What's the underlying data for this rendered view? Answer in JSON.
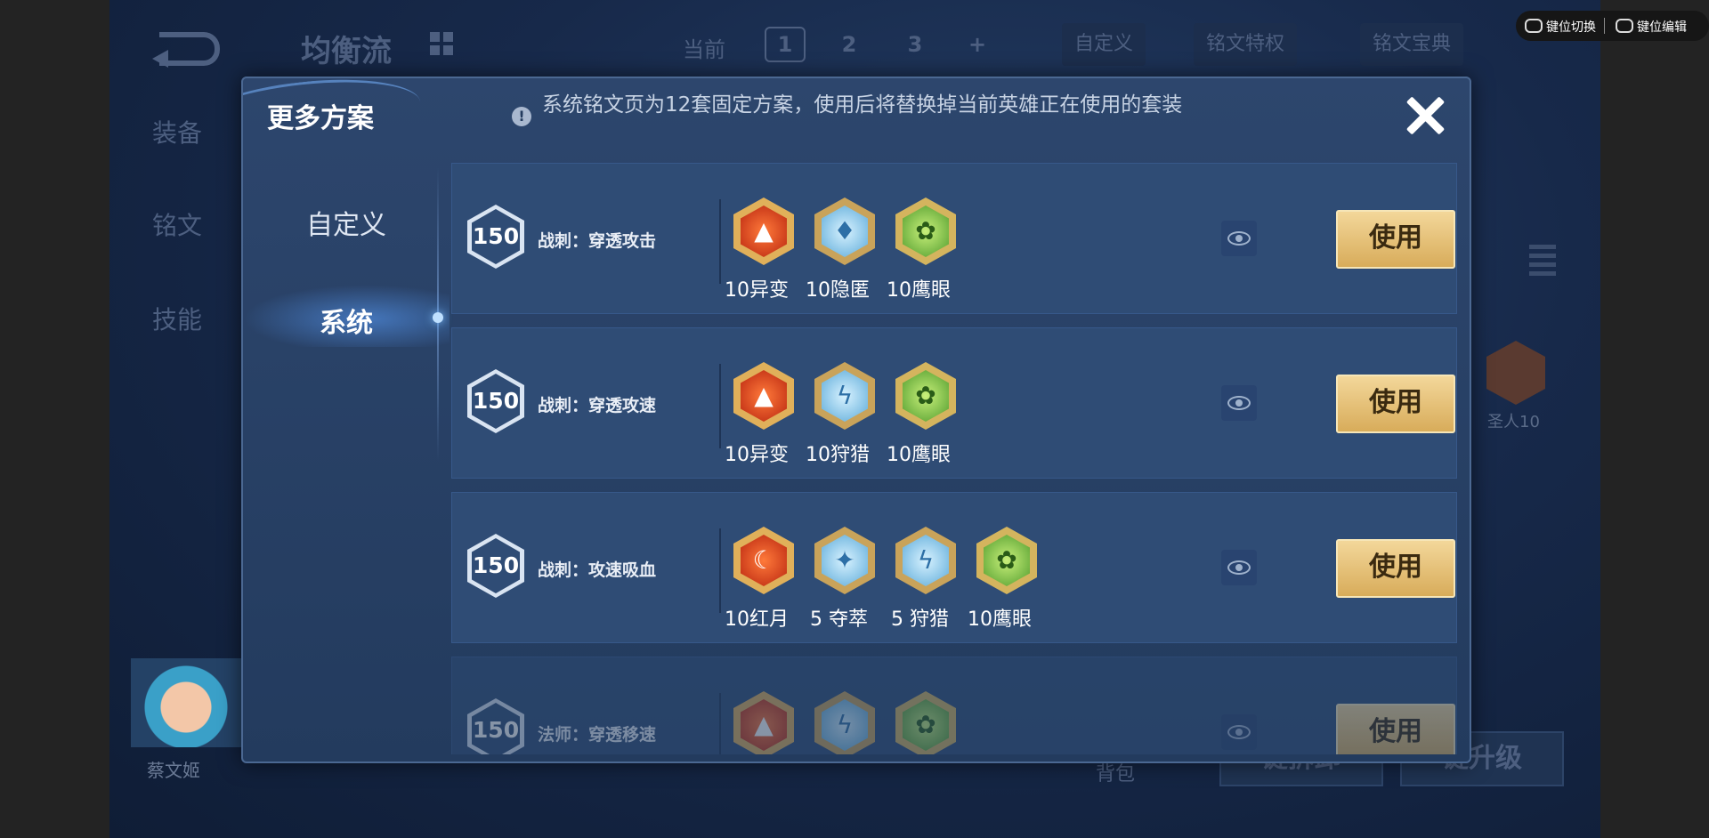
{
  "background": {
    "title": "均衡流",
    "current_label": "当前",
    "pages": [
      "1",
      "2",
      "3",
      "+"
    ],
    "custom_btn": "自定义",
    "privilege_btn": "铭文特权",
    "codex_btn": "铭文宝典",
    "side_tabs": [
      "装备",
      "铭文",
      "技能"
    ],
    "hero_name": "蔡文姬",
    "rune_label": "圣人10",
    "bag_label": "背包",
    "action_upgrade": "键升级",
    "action_other": "键拆卸"
  },
  "overlay": {
    "switch_label": "键位切换",
    "edit_label": "键位编辑"
  },
  "modal": {
    "title": "更多方案",
    "info_text": "系统铭文页为12套固定方案，使用后将替换掉当前英雄正在使用的套装",
    "tabs": {
      "custom": "自定义",
      "system": "系统"
    },
    "use_label": "使用",
    "plans": [
      {
        "level": "150",
        "name": "战刺：穿透攻击",
        "runes": [
          {
            "label": "10异变",
            "color": "red",
            "icon": "mutation-rune-icon"
          },
          {
            "label": "10隐匿",
            "color": "blue",
            "icon": "stealth-rune-icon"
          },
          {
            "label": "10鹰眼",
            "color": "green",
            "icon": "hawkeye-rune-icon"
          }
        ]
      },
      {
        "level": "150",
        "name": "战刺：穿透攻速",
        "runes": [
          {
            "label": "10异变",
            "color": "red",
            "icon": "mutation-rune-icon"
          },
          {
            "label": "10狩猎",
            "color": "blue",
            "icon": "hunt-rune-icon"
          },
          {
            "label": "10鹰眼",
            "color": "green",
            "icon": "hawkeye-rune-icon"
          }
        ]
      },
      {
        "level": "150",
        "name": "战刺：攻速吸血",
        "runes": [
          {
            "label": "10红月",
            "color": "red",
            "icon": "red-moon-rune-icon"
          },
          {
            "label": "5 夺萃",
            "color": "blue",
            "icon": "plunder-rune-icon"
          },
          {
            "label": "5 狩猎",
            "color": "blue",
            "icon": "hunt-rune-icon"
          },
          {
            "label": "10鹰眼",
            "color": "green",
            "icon": "hawkeye-rune-icon"
          }
        ]
      },
      {
        "level": "150",
        "name": "法师：穿透移速",
        "runes": [
          {
            "label": "",
            "color": "red",
            "icon": "rune-icon"
          },
          {
            "label": "",
            "color": "blue",
            "icon": "rune-icon"
          },
          {
            "label": "",
            "color": "green",
            "icon": "rune-icon"
          }
        ]
      }
    ]
  }
}
